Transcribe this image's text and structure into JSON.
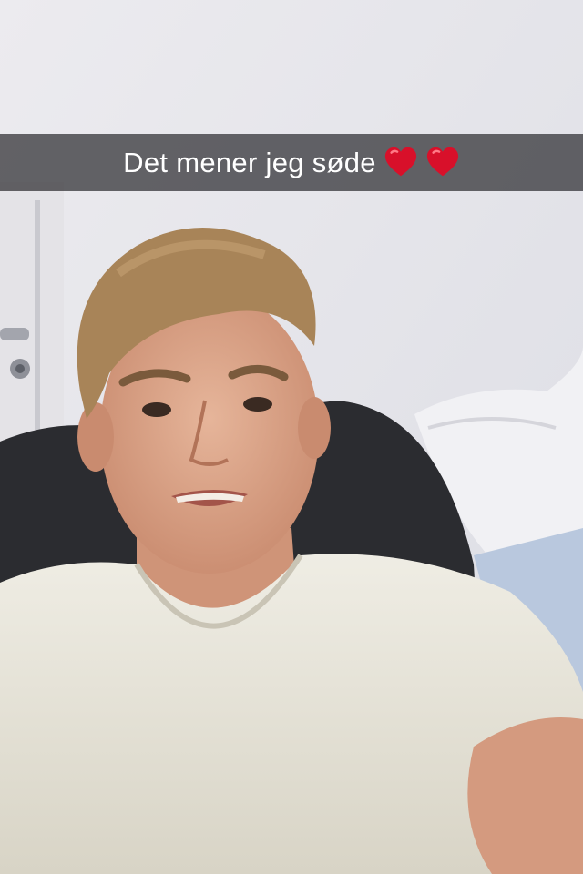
{
  "snap": {
    "caption": "Det mener jeg søde",
    "emoji": [
      "heart-icon",
      "heart-icon"
    ]
  },
  "colors": {
    "caption_bar": "#2d2d30",
    "caption_text": "#ffffff",
    "heart": "#d8102a"
  }
}
